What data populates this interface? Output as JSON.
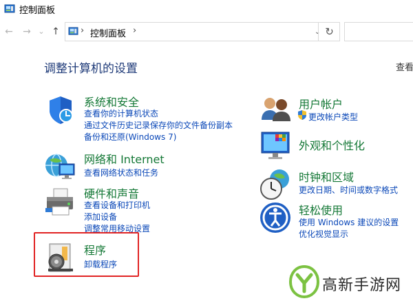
{
  "window": {
    "title": "控制面板"
  },
  "nav": {
    "back": "←",
    "forward": "→",
    "recent": "⌄",
    "up": "↑",
    "address_sep": "›",
    "address_crumb": "控制面板",
    "address_dropdown": "⌄",
    "refresh": "↻"
  },
  "page": {
    "heading": "调整计算机的设置",
    "view_by": "查看"
  },
  "categories": [
    {
      "title": "系统和安全",
      "links": [
        "查看你的计算机状态",
        "通过文件历史记录保存你的文件备份副本",
        "备份和还原(Windows 7)"
      ]
    },
    {
      "title": "网络和 Internet",
      "links": [
        "查看网络状态和任务"
      ]
    },
    {
      "title": "硬件和声音",
      "links": [
        "查看设备和打印机",
        "添加设备",
        "调整常用移动设置"
      ]
    },
    {
      "title": "程序",
      "links": [
        "卸载程序"
      ]
    },
    {
      "title": "用户帐户",
      "links": [
        "更改帐户类型"
      ]
    },
    {
      "title": "外观和个性化",
      "links": []
    },
    {
      "title": "时钟和区域",
      "links": [
        "更改日期、时间或数字格式"
      ]
    },
    {
      "title": "轻松使用",
      "links": [
        "使用 Windows 建议的设置",
        "优化视觉显示"
      ]
    }
  ],
  "watermark": {
    "text": "高新手游网"
  },
  "colors": {
    "category_title": "#147836",
    "link": "#0b48b8",
    "heading": "#1e3a78",
    "highlight_box": "#e12323"
  }
}
